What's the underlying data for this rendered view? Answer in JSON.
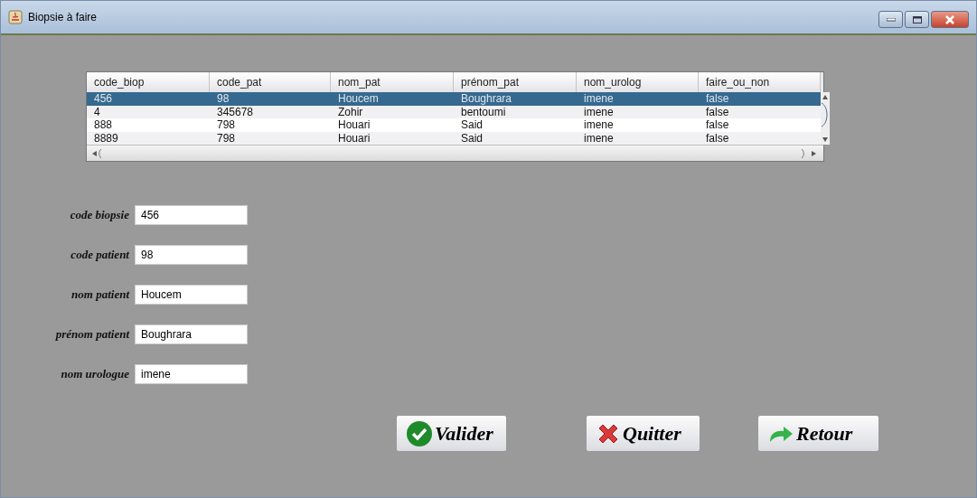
{
  "window": {
    "title": "Biopsie à faire"
  },
  "table": {
    "columns": [
      "code_biop",
      "code_pat",
      "nom_pat",
      "prénom_pat",
      "nom_urolog",
      "faire_ou_non"
    ],
    "rows": [
      {
        "cells": [
          "456",
          "98",
          "Houcem",
          "Boughrara",
          "imene",
          "false"
        ],
        "selected": true
      },
      {
        "cells": [
          "4",
          "345678",
          "Zohir",
          "bentoumi",
          "imene",
          "false"
        ],
        "selected": false
      },
      {
        "cells": [
          "888",
          "798",
          "Houari",
          "Said",
          "imene",
          "false"
        ],
        "selected": false
      },
      {
        "cells": [
          "8889",
          "798",
          "Houari",
          "Said",
          "imene",
          "false"
        ],
        "selected": false
      }
    ]
  },
  "form": [
    {
      "label": "code biopsie",
      "value": "456"
    },
    {
      "label": "code patient",
      "value": "98"
    },
    {
      "label": "nom patient",
      "value": "Houcem"
    },
    {
      "label": "prénom patient",
      "value": "Boughrara"
    },
    {
      "label": "nom urologue",
      "value": "imene"
    }
  ],
  "buttons": [
    {
      "kind": "check",
      "label": "Valider"
    },
    {
      "kind": "cross",
      "label": "Quitter"
    },
    {
      "kind": "redo",
      "label": "Retour"
    }
  ]
}
